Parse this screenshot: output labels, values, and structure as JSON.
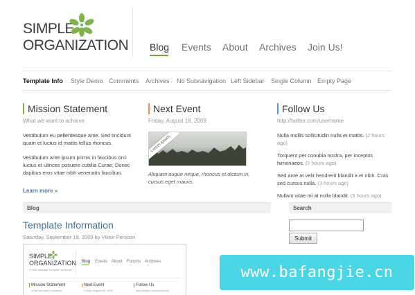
{
  "logo": {
    "line1": "SIMPLE",
    "line2": "ORGANIZATION",
    "icon": "green-flower-icon"
  },
  "main_nav": {
    "items": [
      {
        "label": "Blog",
        "active": true
      },
      {
        "label": "Events"
      },
      {
        "label": "About"
      },
      {
        "label": "Archives"
      },
      {
        "label": "Join Us!"
      }
    ]
  },
  "sub_nav": {
    "items": [
      "Template Info",
      "Style Demo",
      "Comments",
      "Archives",
      "No Subnavigation",
      "Left Sidebar",
      "Single Column",
      "Empty Page"
    ]
  },
  "mission": {
    "title": "Mission Statement",
    "subtitle": "What we want to achieve",
    "p1": "Vestibulum eu pellentesque ante. Sed tincidunt quam et luctus id mattis tellus rhoncus.",
    "p2": "Vestibulum ante ipsum primis in faucibus orci luctus et ultrices posuere cubilia Curae; Donec dapibus eros vitae nibh venenatis faucibus.",
    "more": "Learn more »"
  },
  "event": {
    "title": "Next Event",
    "date": "Friday, August 18, 2009",
    "ribbon": "Lorem ipsum",
    "caption": "Aliquam augue neque, rhoncus et dictum in, cursus eget mauris."
  },
  "follow": {
    "title": "Follow Us",
    "url": "http://twitter.com/username",
    "tweets": [
      {
        "text": "Nulla mollis sollicitudin nulla et mattis.",
        "time": "(2 hours ago)"
      },
      {
        "text": "Torquent per conubia nostra, per inceptos himenaeos.",
        "time": "(2 hours ago)"
      },
      {
        "text": "Sed ante at velit hendrerit blandit a et nibh. Cras sed cursus nulla.",
        "time": "(3 hours ago)"
      },
      {
        "text": "Nullam vitae mi at nulla blandit.",
        "time": "(5 hours ago)"
      }
    ]
  },
  "blog": {
    "panel_title": "Blog",
    "post_title": "Template Information",
    "post_meta": "Saturday, September 19, 2009 by Viktor Persson"
  },
  "search": {
    "panel_title": "Search",
    "button": "Submit",
    "value": ""
  },
  "thumbnail": {
    "logo_line1": "SIMPLE",
    "logo_line2": "ORGANIZATION",
    "tagline": "A Free Website Template by Arcsin",
    "nav": [
      "Blog",
      "Events",
      "About",
      "Forums",
      "Archives"
    ],
    "col1": "Mission Statement",
    "col1_sub": "What we want to achieve",
    "col2": "Next Event",
    "col2_sub": "Friday, August 18, 2009",
    "col3": "Follow Us",
    "col3_sub": "http://twitter.com/username"
  },
  "watermark": "www.bafangjie.cn",
  "colors": {
    "accent_green": "#7fb24f",
    "accent_orange": "#e88a4a",
    "accent_blue": "#5a97d2",
    "link_blue": "#3a7dbf",
    "watermark_bg": "#4ad6e3"
  }
}
